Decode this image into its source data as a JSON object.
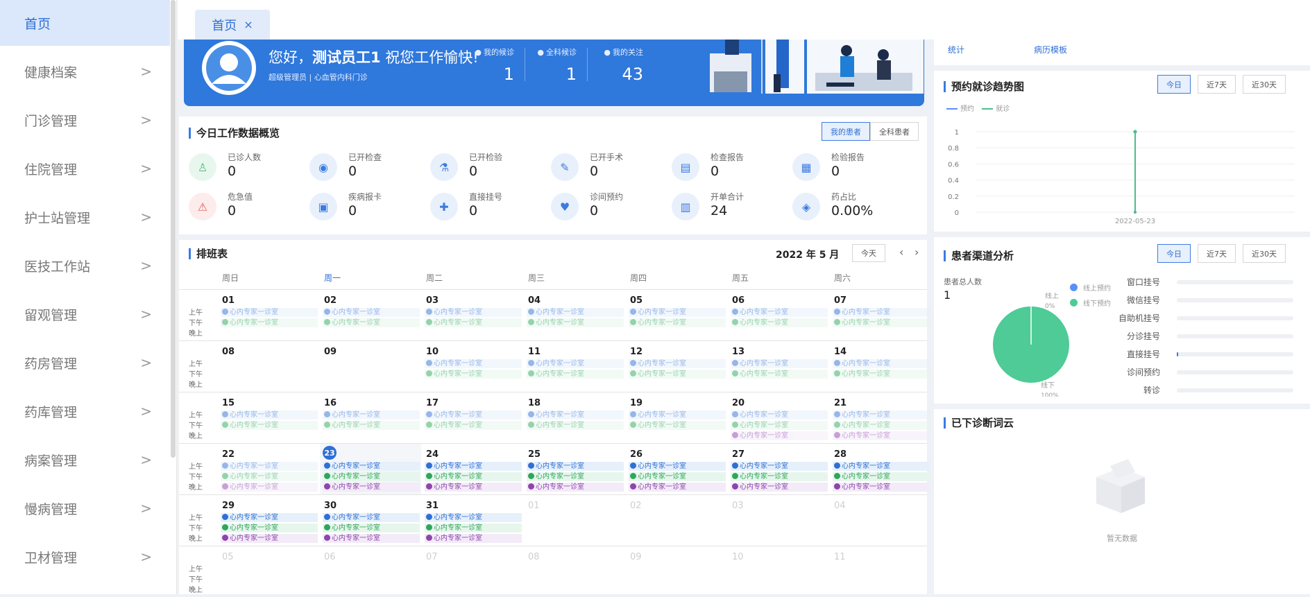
{
  "sidebar": {
    "items": [
      {
        "label": "首页",
        "active": true
      },
      {
        "label": "健康档案"
      },
      {
        "label": "门诊管理"
      },
      {
        "label": "住院管理"
      },
      {
        "label": "护士站管理"
      },
      {
        "label": "医技工作站"
      },
      {
        "label": "留观管理"
      },
      {
        "label": "药房管理"
      },
      {
        "label": "药库管理"
      },
      {
        "label": "病案管理"
      },
      {
        "label": "慢病管理"
      },
      {
        "label": "卫材管理"
      }
    ],
    "chevron": ">"
  },
  "tabs": {
    "home_label": "首页",
    "close_glyph": "×"
  },
  "banner": {
    "greeting_prefix": "您好，",
    "user_name": "测试员工1",
    "greeting_suffix": " 祝您工作愉快!",
    "role": "超级管理员",
    "separator": "|",
    "department": "心血管内科门诊",
    "stats": [
      {
        "label": "我的候诊",
        "value": "1"
      },
      {
        "label": "全科候诊",
        "value": "1"
      },
      {
        "label": "我的关注",
        "value": "43"
      }
    ]
  },
  "overview": {
    "title": "今日工作数据概览",
    "toggle": [
      "我的患者",
      "全科患者"
    ],
    "items": [
      {
        "label": "已诊人数",
        "value": "0",
        "icon": "doctor-icon",
        "color": "#4ebd7c"
      },
      {
        "label": "已开检查",
        "value": "0",
        "icon": "scan-icon",
        "color": "#3b7be0"
      },
      {
        "label": "已开检验",
        "value": "0",
        "icon": "test-tube-icon",
        "color": "#3b7be0"
      },
      {
        "label": "已开手术",
        "value": "0",
        "icon": "scalpel-icon",
        "color": "#3b7be0"
      },
      {
        "label": "检查报告",
        "value": "0",
        "icon": "report-icon",
        "color": "#3b7be0"
      },
      {
        "label": "检验报告",
        "value": "0",
        "icon": "lab-report-icon",
        "color": "#3b7be0"
      },
      {
        "label": "危急值",
        "value": "0",
        "icon": "alarm-icon",
        "color": "#e05a5a"
      },
      {
        "label": "疾病报卡",
        "value": "0",
        "icon": "card-icon",
        "color": "#3b7be0"
      },
      {
        "label": "直接挂号",
        "value": "0",
        "icon": "register-icon",
        "color": "#3b7be0"
      },
      {
        "label": "诊间预约",
        "value": "0",
        "icon": "heart-plus-icon",
        "color": "#3b7be0"
      },
      {
        "label": "开单合计",
        "value": "24",
        "icon": "bill-icon",
        "color": "#3b7be0"
      },
      {
        "label": "药占比",
        "value": "0.00%",
        "icon": "pill-icon",
        "color": "#3b7be0"
      }
    ]
  },
  "schedule": {
    "title": "排班表",
    "month_label": "2022 年 5 月",
    "today_button": "今天",
    "prev_glyph": "‹",
    "next_glyph": "›",
    "weekdays": [
      "周日",
      "周一",
      "周二",
      "周三",
      "周四",
      "周五",
      "周六"
    ],
    "slots": [
      "上午",
      "下午",
      "晚上"
    ],
    "entry_text": "心内专家一诊室",
    "weeks": [
      [
        "01",
        "02",
        "03",
        "04",
        "05",
        "06",
        "07"
      ],
      [
        "08",
        "09",
        "10",
        "11",
        "12",
        "13",
        "14"
      ],
      [
        "15",
        "16",
        "17",
        "18",
        "19",
        "20",
        "21"
      ],
      [
        "22",
        "23",
        "24",
        "25",
        "26",
        "27",
        "28"
      ],
      [
        "29",
        "30",
        "31",
        "01",
        "02",
        "03",
        "04"
      ],
      [
        "05",
        "06",
        "07",
        "08",
        "09",
        "10",
        "11"
      ]
    ]
  },
  "top_right": {
    "links": [
      "统计",
      "病历模板"
    ]
  },
  "trend": {
    "title": "预约就诊趋势图",
    "range_buttons": [
      "今日",
      "近7天",
      "近30天"
    ],
    "legend": [
      {
        "name": "预约",
        "color": "#5b8ff9"
      },
      {
        "name": "就诊",
        "color": "#4ebd8c"
      }
    ]
  },
  "chart_data": {
    "type": "line",
    "title": "预约就诊趋势图",
    "x": [
      "2022-05-23"
    ],
    "series": [
      {
        "name": "预约",
        "values": [
          1
        ]
      },
      {
        "name": "就诊",
        "values": [
          1
        ]
      }
    ],
    "ylim": [
      0,
      1
    ],
    "yticks": [
      "1",
      "0.8",
      "0.6",
      "0.4",
      "0.2",
      "0"
    ],
    "grid": true,
    "legend": "top-left"
  },
  "channels": {
    "title": "患者渠道分析",
    "range_buttons": [
      "今日",
      "近7天",
      "近30天"
    ],
    "total_label": "患者总人数",
    "total_value": "1",
    "pie_legend": [
      {
        "name": "线上预约",
        "color": "#5b8ff9"
      },
      {
        "name": "线下预约",
        "color": "#4ecb96"
      }
    ],
    "pie": [
      {
        "label": "线上",
        "pct": "0%",
        "value": 0
      },
      {
        "label": "线下",
        "pct": "100%",
        "value": 100
      }
    ],
    "bars": [
      {
        "label": "窗口挂号",
        "value": 0
      },
      {
        "label": "微信挂号",
        "value": 0
      },
      {
        "label": "自助机挂号",
        "value": 0
      },
      {
        "label": "分诊挂号",
        "value": 0
      },
      {
        "label": "直接挂号",
        "value": 0.01
      },
      {
        "label": "诊间预约",
        "value": 0
      },
      {
        "label": "转诊",
        "value": 0
      }
    ]
  },
  "wordcloud": {
    "title": "已下诊断词云",
    "empty_text": "暂无数据"
  }
}
